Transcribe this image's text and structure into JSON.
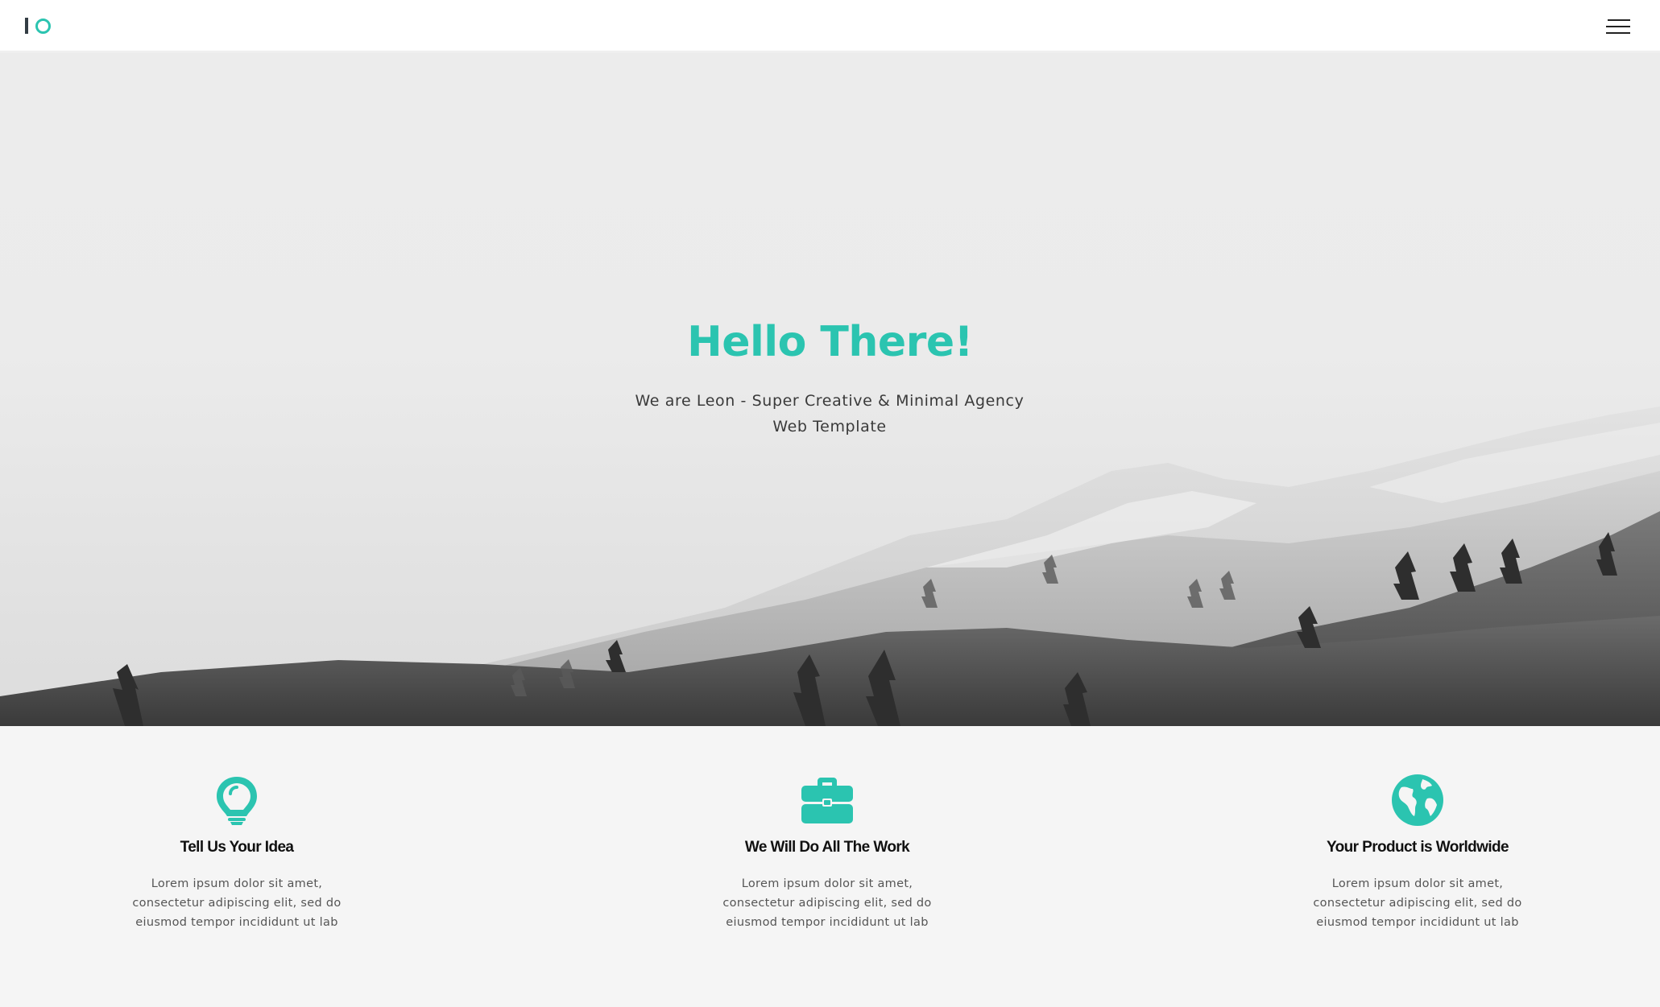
{
  "brand": {
    "accent_color": "#2bc4b0",
    "logo_icon": "io-logo-icon"
  },
  "header": {
    "menu_icon": "hamburger-menu-icon"
  },
  "hero": {
    "title": "Hello There!",
    "subtitle": "We are Leon - Super Creative & Minimal Agency Web Template",
    "background": "snowy-mountain-landscape-grayscale"
  },
  "features": [
    {
      "icon": "lightbulb-icon",
      "title": "Tell Us Your Idea",
      "text": "Lorem ipsum dolor sit amet, consectetur adipiscing elit, sed do eiusmod tempor incididunt ut lab"
    },
    {
      "icon": "briefcase-icon",
      "title": "We Will Do All The Work",
      "text": "Lorem ipsum dolor sit amet, consectetur adipiscing elit, sed do eiusmod tempor incididunt ut lab"
    },
    {
      "icon": "globe-icon",
      "title": "Your Product is Worldwide",
      "text": "Lorem ipsum dolor sit amet, consectetur adipiscing elit, sed do eiusmod tempor incididunt ut lab"
    }
  ]
}
